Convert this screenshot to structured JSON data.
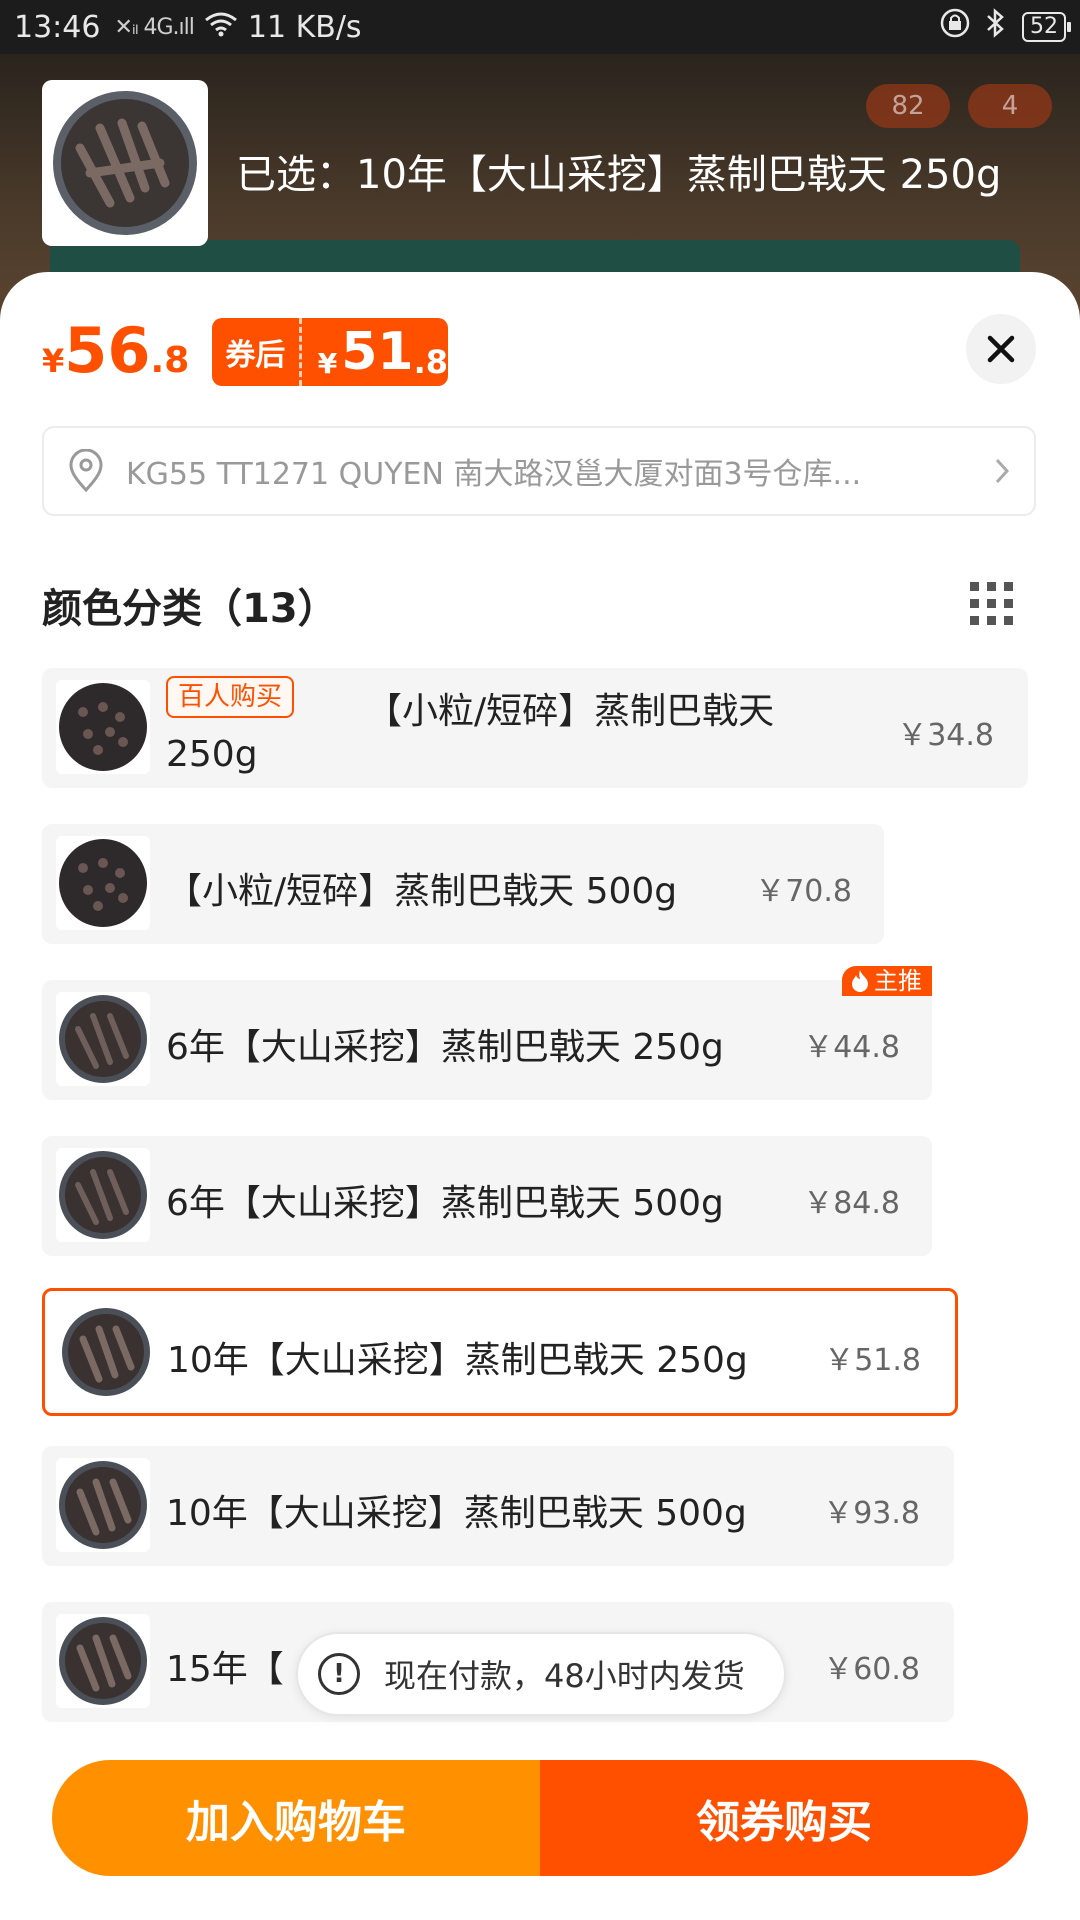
{
  "status_bar": {
    "time": "13:46",
    "signal_text": "✕ᵢₗ 4G.ıll",
    "speed": "11 KB/s",
    "battery": "52"
  },
  "header": {
    "selected_label": "已选：10年【大山采挖】蒸制巴戟天 250g",
    "badge_share": "82",
    "badge_cart": "4"
  },
  "price": {
    "currency": "¥",
    "integer": "56",
    "decimal": ".8",
    "coupon_label": "券后",
    "coupon_currency": "¥",
    "coupon_integer": "51",
    "coupon_decimal": ".8"
  },
  "address": {
    "text": "KG55 TT1271 QUYEN 南大路汉邕大厦对面3号仓库..."
  },
  "section": {
    "title": "颜色分类（13）"
  },
  "options": [
    {
      "tag": "百人购买",
      "label_line1": "【小粒/短碎】蒸制巴戟天",
      "label_line2": "250g",
      "price": "￥34.8"
    },
    {
      "label": "【小粒/短碎】蒸制巴戟天 500g",
      "price": "￥70.8"
    },
    {
      "tag": "主推",
      "label": "6年【大山采挖】蒸制巴戟天 250g",
      "price": "￥44.8"
    },
    {
      "label": "6年【大山采挖】蒸制巴戟天 500g",
      "price": "￥84.8"
    },
    {
      "label": "10年【大山采挖】蒸制巴戟天 250g",
      "price": "￥51.8",
      "selected": true
    },
    {
      "label": "10年【大山采挖】蒸制巴戟天 500g",
      "price": "￥93.8"
    },
    {
      "label": "15年【",
      "price": "￥60.8"
    }
  ],
  "toast": {
    "text": "现在付款，48小时内发货"
  },
  "actions": {
    "add_to_cart": "加入购物车",
    "buy_now": "领券购买"
  },
  "colors": {
    "accent": "#ff5000",
    "secondary": "#ff9000"
  },
  "icons": [
    "location-pin-icon",
    "chevron-right-icon",
    "close-icon",
    "grid-view-icon",
    "fire-icon",
    "exclamation-icon",
    "wifi-icon",
    "lock-icon",
    "bluetooth-icon"
  ]
}
